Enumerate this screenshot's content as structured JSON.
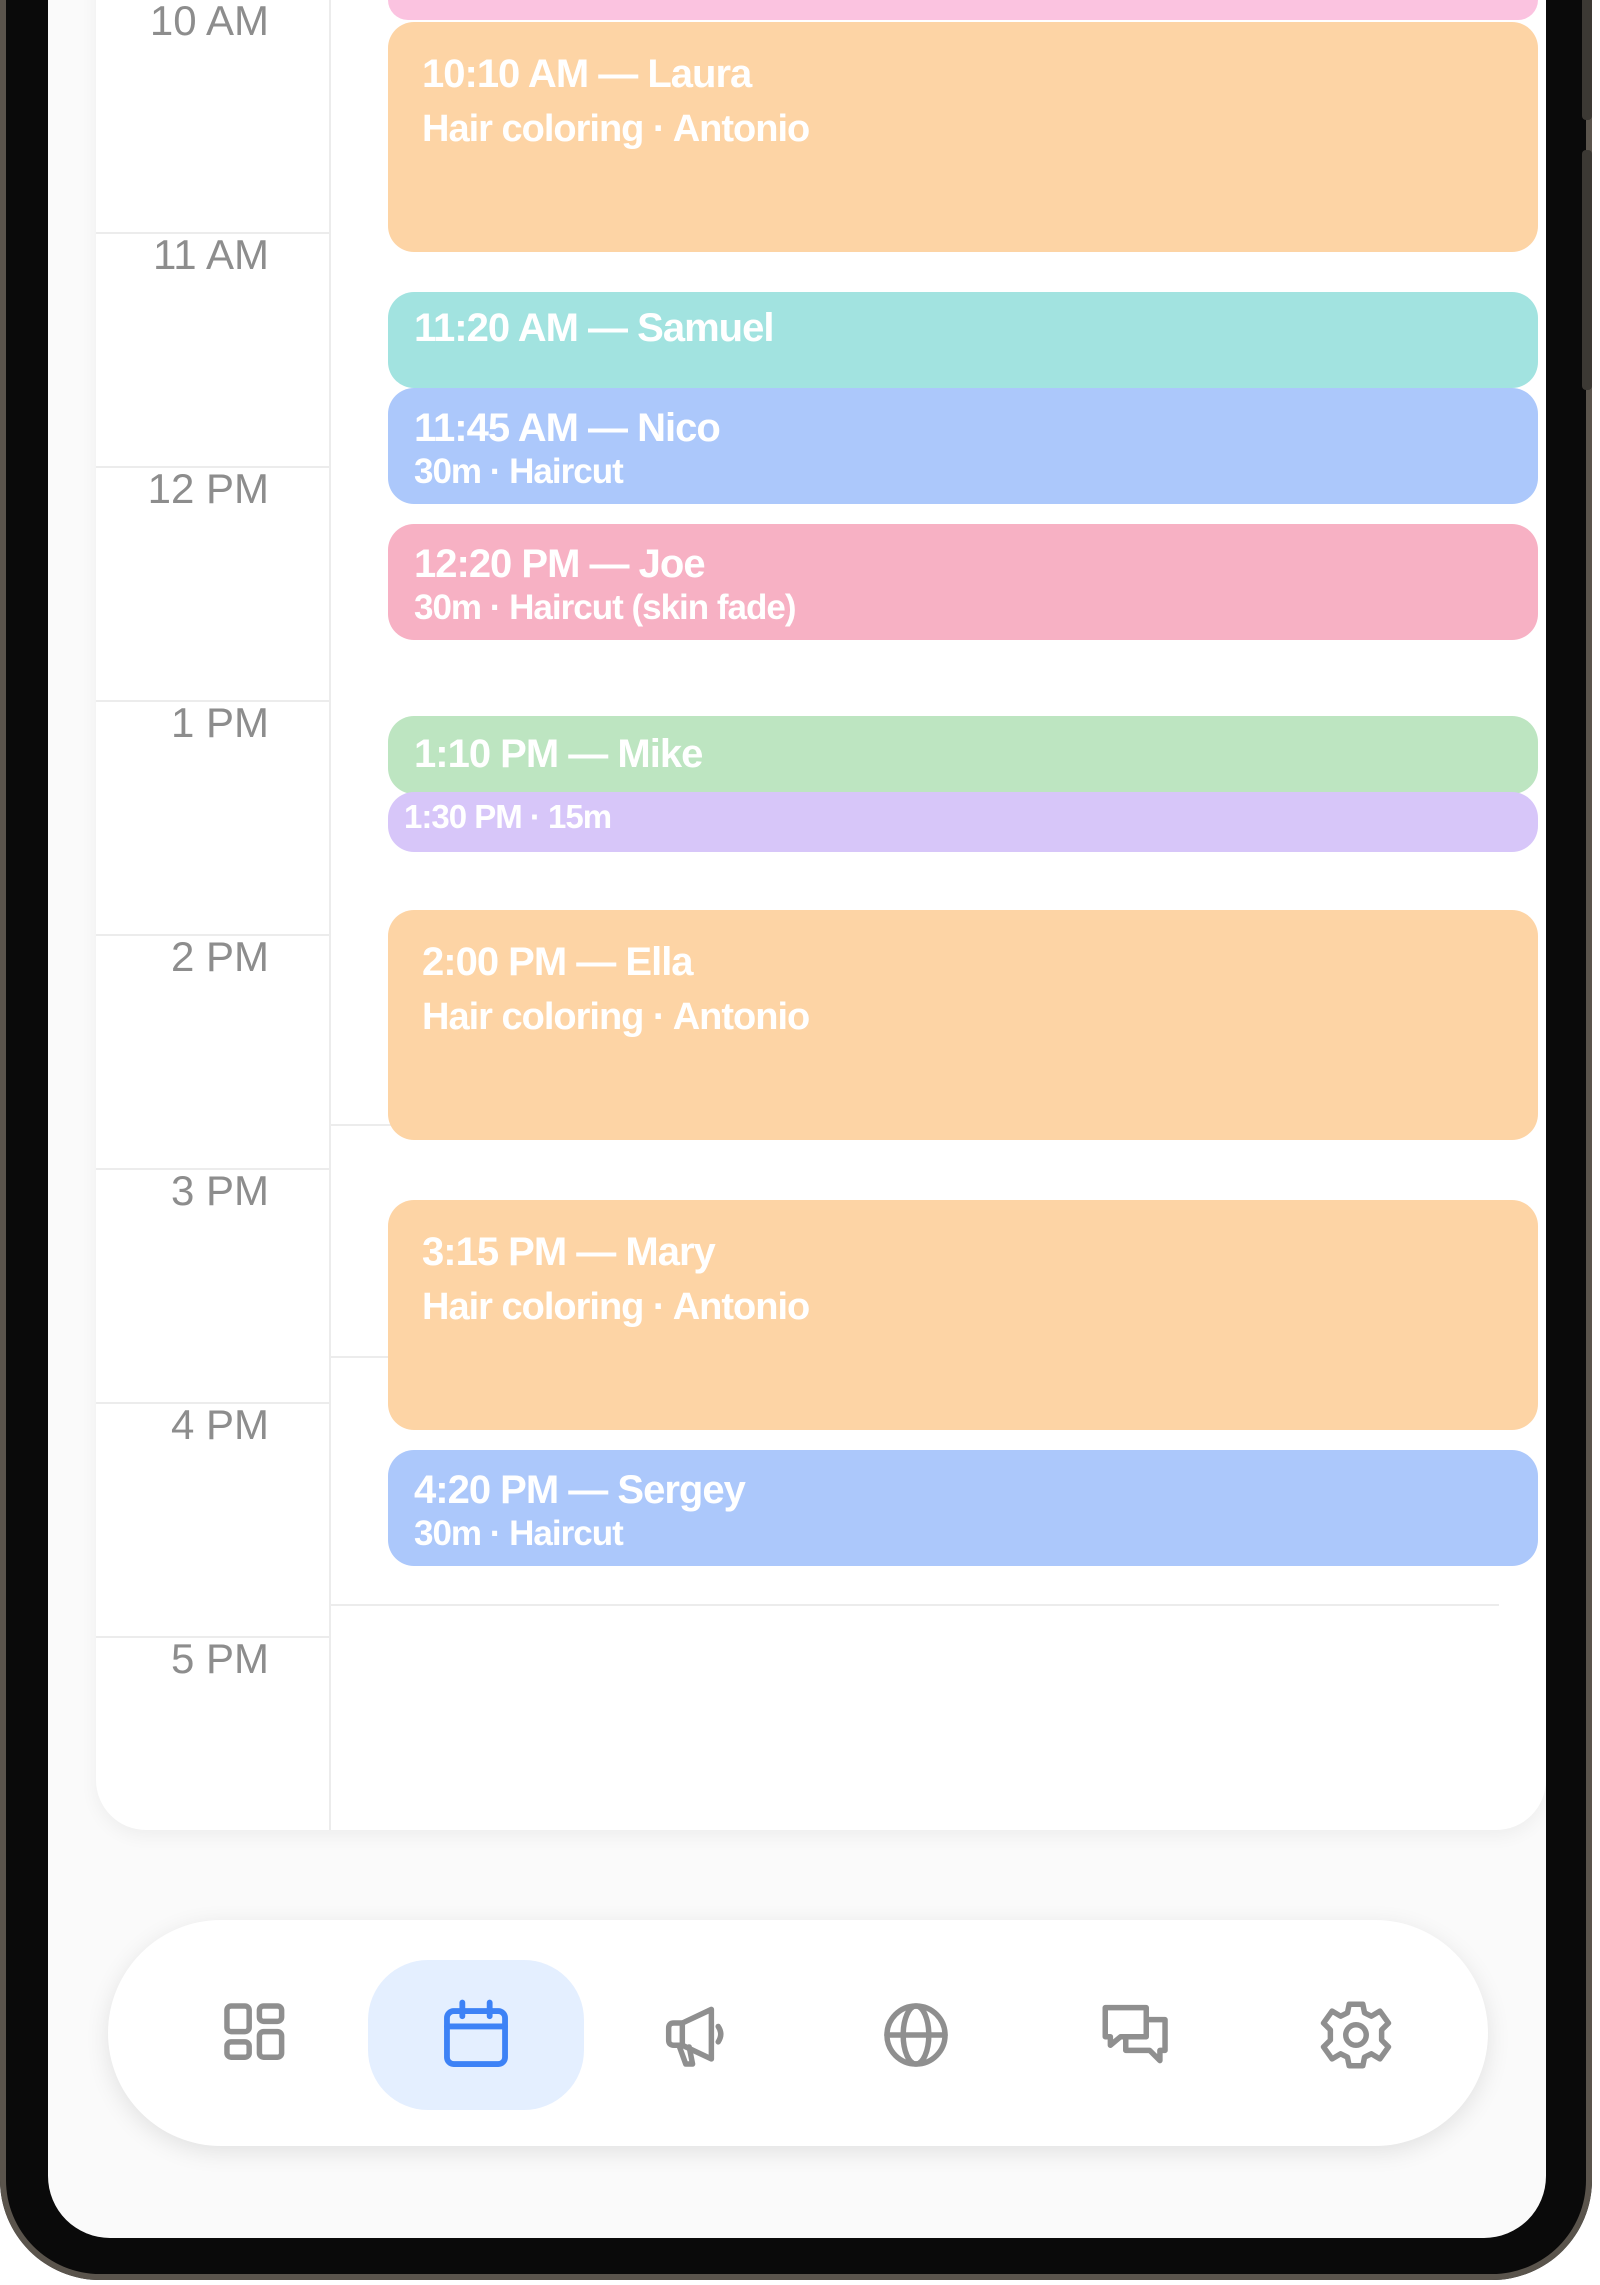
{
  "calendar": {
    "hours": [
      "10 AM",
      "11 AM",
      "12 PM",
      "1 PM",
      "2 PM",
      "3 PM",
      "4 PM",
      "5 PM"
    ],
    "appointments": [
      {
        "title": "10:10 AM — Laura",
        "subtitle": "Hair coloring · Antonio",
        "color": "#fdd4a5"
      },
      {
        "title": "11:20 AM — Samuel",
        "subtitle": "",
        "color": "#a2e3e0"
      },
      {
        "title": "11:45 AM — Nico",
        "subtitle": "30m · Haircut",
        "color": "#acc8fb"
      },
      {
        "title": "12:20 PM — Joe",
        "subtitle": "30m · Haircut (skin fade)",
        "color": "#f7b1c4"
      },
      {
        "title": "1:10 PM — Mike",
        "subtitle": "",
        "color": "#bde5c1"
      },
      {
        "title": "1:30 PM · 15m",
        "subtitle": "",
        "color": "#d7c6f9"
      },
      {
        "title": "2:00 PM — Ella",
        "subtitle": "Hair coloring · Antonio",
        "color": "#fdd4a5"
      },
      {
        "title": "3:15 PM — Mary",
        "subtitle": "Hair coloring · Antonio",
        "color": "#fdd4a5"
      },
      {
        "title": "4:20 PM — Sergey",
        "subtitle": "30m · Haircut",
        "color": "#acc8fb"
      }
    ],
    "top_partial_color": "#fbc3e0"
  },
  "nav": {
    "active": "calendar",
    "items": [
      {
        "icon": "dashboard-icon"
      },
      {
        "icon": "calendar-icon"
      },
      {
        "icon": "megaphone-icon"
      },
      {
        "icon": "globe-icon"
      },
      {
        "icon": "chat-icon"
      },
      {
        "icon": "settings-icon"
      }
    ],
    "active_color": "#3d82f6",
    "inactive_color": "#8f8f8f"
  }
}
